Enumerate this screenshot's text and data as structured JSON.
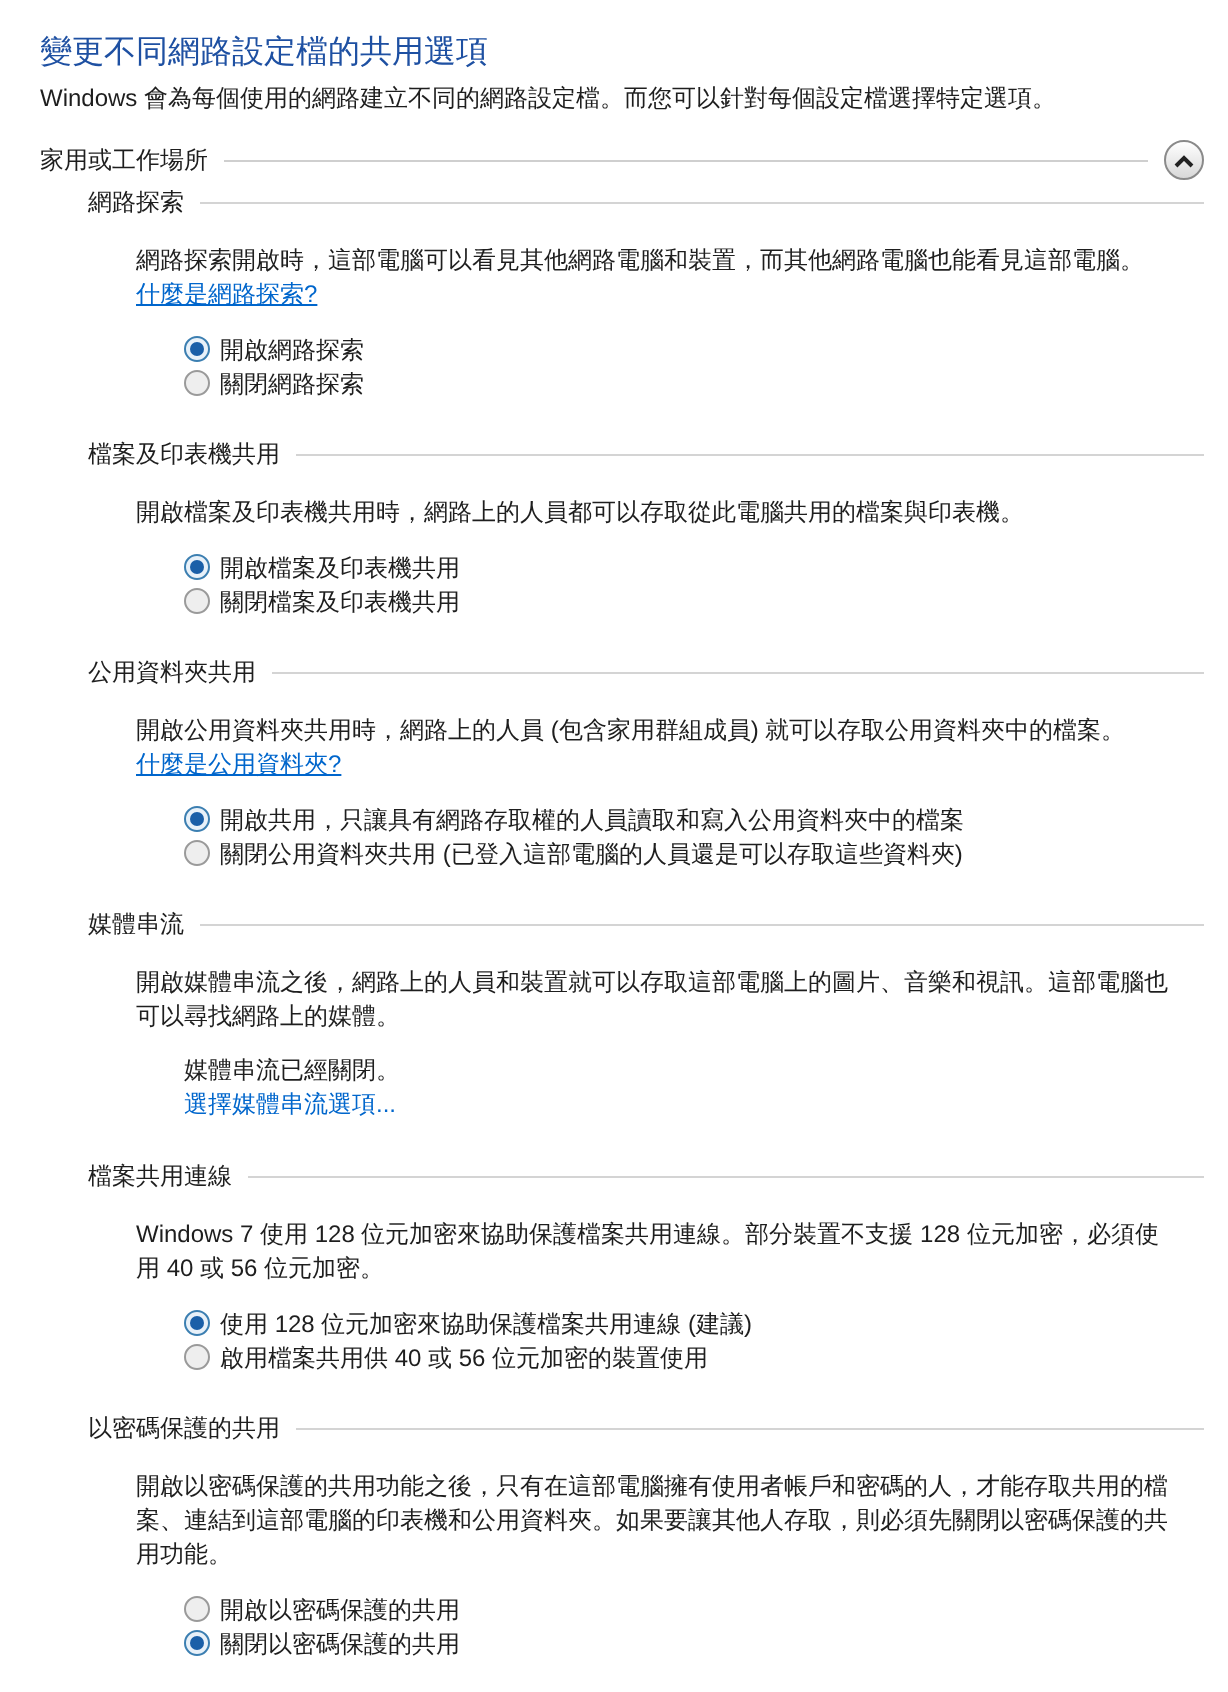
{
  "title": "變更不同網路設定檔的共用選項",
  "subtitle": "Windows 會為每個使用的網路建立不同的網路設定檔。而您可以針對每個設定檔選擇特定選項。",
  "group": {
    "label": "家用或工作場所",
    "expanded": true
  },
  "sections": [
    {
      "title": "網路探索",
      "description": "網路探索開啟時，這部電腦可以看見其他網路電腦和裝置，而其他網路電腦也能看見這部電腦。",
      "link": "什麼是網路探索?",
      "kind": "radio",
      "options": [
        {
          "label": "開啟網路探索",
          "selected": true
        },
        {
          "label": "關閉網路探索",
          "selected": false
        }
      ]
    },
    {
      "title": "檔案及印表機共用",
      "description": "開啟檔案及印表機共用時，網路上的人員都可以存取從此電腦共用的檔案與印表機。",
      "kind": "radio",
      "options": [
        {
          "label": "開啟檔案及印表機共用",
          "selected": true
        },
        {
          "label": "關閉檔案及印表機共用",
          "selected": false
        }
      ]
    },
    {
      "title": "公用資料夾共用",
      "description": "開啟公用資料夾共用時，網路上的人員 (包含家用群組成員) 就可以存取公用資料夾中的檔案。",
      "link": "什麼是公用資料夾?",
      "kind": "radio",
      "options": [
        {
          "label": "開啟共用，只讓具有網路存取權的人員讀取和寫入公用資料夾中的檔案",
          "selected": true
        },
        {
          "label": "關閉公用資料夾共用 (已登入這部電腦的人員還是可以存取這些資料夾)",
          "selected": false
        }
      ]
    },
    {
      "title": "媒體串流",
      "description": "開啟媒體串流之後，網路上的人員和裝置就可以存取這部電腦上的圖片、音樂和視訊。這部電腦也可以尋找網路上的媒體。",
      "kind": "status",
      "status": "媒體串流已經關閉。",
      "action": "選擇媒體串流選項..."
    },
    {
      "title": "檔案共用連線",
      "description": "Windows 7 使用 128 位元加密來協助保護檔案共用連線。部分裝置不支援 128 位元加密，必須使用 40 或 56 位元加密。",
      "kind": "radio",
      "options": [
        {
          "label": "使用 128 位元加密來協助保護檔案共用連線 (建議)",
          "selected": true
        },
        {
          "label": "啟用檔案共用供 40 或 56 位元加密的裝置使用",
          "selected": false
        }
      ]
    },
    {
      "title": "以密碼保護的共用",
      "description": "開啟以密碼保護的共用功能之後，只有在這部電腦擁有使用者帳戶和密碼的人，才能存取共用的檔案、連結到這部電腦的印表機和公用資料夾。如果要讓其他人存取，則必須先關閉以密碼保護的共用功能。",
      "kind": "radio",
      "options": [
        {
          "label": "開啟以密碼保護的共用",
          "selected": false
        },
        {
          "label": "關閉以密碼保護的共用",
          "selected": true
        }
      ]
    }
  ]
}
